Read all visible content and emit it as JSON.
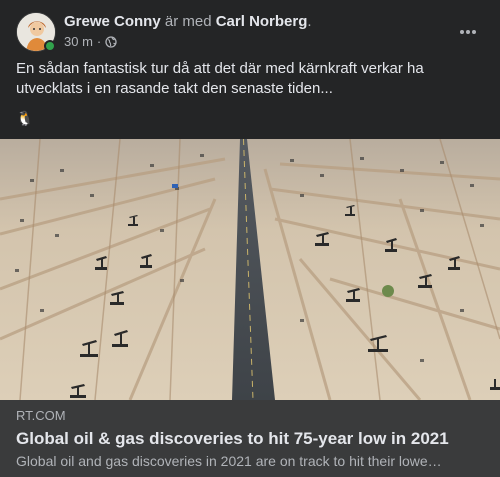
{
  "post": {
    "author": "Grewe Conny",
    "with_text": "är med",
    "tagged": "Carl Norberg",
    "tagged_suffix": ".",
    "time": "30 m",
    "separator": "·",
    "audience_icon": "globe-icon",
    "more_icon": "more-horizontal-icon",
    "text": "En sådan fantastisk tur då att det där med kärnkraft verkar ha utvecklats i en rasande takt den senaste tiden...",
    "emoji": "🐧"
  },
  "link": {
    "domain": "RT.COM",
    "title": "Global oil & gas discoveries to hit 75-year low in 2021",
    "description": "Global oil and gas discoveries in 2021 are on track to hit their lowe…"
  },
  "colors": {
    "background": "#242526",
    "link_background": "#3a3b3c",
    "primary_text": "#e4e6eb",
    "secondary_text": "#b0b3b8",
    "online": "#31a24c"
  }
}
